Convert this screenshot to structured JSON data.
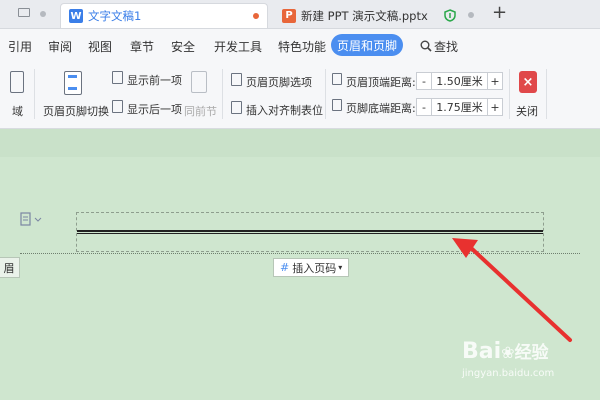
{
  "tabs": [
    {
      "label": "文字文稿1",
      "icon": "W",
      "color": "#3a7ee8"
    },
    {
      "label": "新建 PPT 演示文稿.pptx",
      "icon": "P",
      "color": "#e8663a"
    }
  ],
  "tab_add": "+",
  "menu": [
    "引用",
    "审阅",
    "视图",
    "章节",
    "安全",
    "开发工具",
    "特色功能"
  ],
  "menu_active": "页眉和页脚",
  "search_label": "查找",
  "ribbon": {
    "field_label": "域",
    "switch_label": "页眉页脚切换",
    "show_prev": "显示前一项",
    "show_next": "显示后一项",
    "same_as_prev": "同前节",
    "options_label": "页眉页脚选项",
    "insert_tab_label": "插入对齐制表位",
    "header_top_label": "页眉顶端距离:",
    "header_top_value": "1.50厘米",
    "footer_bottom_label": "页脚底端距离:",
    "footer_bottom_value": "1.75厘米",
    "minus": "-",
    "plus": "+",
    "close_label": "关闭"
  },
  "page": {
    "header_tag": "眉",
    "insert_page_label": "插入页码"
  },
  "watermark": {
    "brand": "Bai",
    "brand2": "经验",
    "url": "jingyan.baidu.com"
  },
  "colors": {
    "accent": "#4b8ef0",
    "close": "#e0484a",
    "arrow": "#e8312f",
    "page_bg": "#cfe6cf"
  }
}
